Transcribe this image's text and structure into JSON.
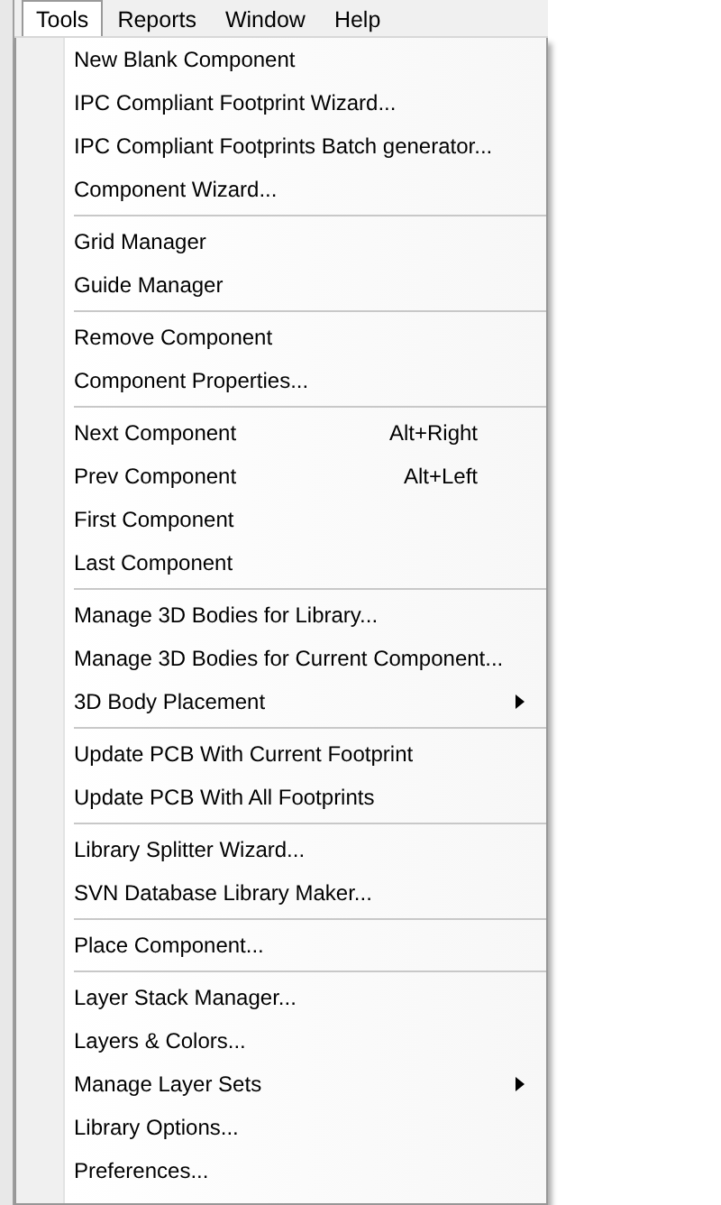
{
  "menubar": {
    "items": [
      {
        "label": "Tools",
        "selected": true
      },
      {
        "label": "Reports",
        "selected": false
      },
      {
        "label": "Window",
        "selected": false
      },
      {
        "label": "Help",
        "selected": false
      }
    ]
  },
  "menu": {
    "groups": [
      {
        "items": [
          {
            "label": "New Blank Component",
            "submenu": false
          },
          {
            "label": "IPC Compliant Footprint Wizard...",
            "submenu": false
          },
          {
            "label": "IPC Compliant Footprints Batch generator...",
            "submenu": false
          },
          {
            "label": "Component Wizard...",
            "submenu": false
          }
        ]
      },
      {
        "items": [
          {
            "label": "Grid Manager",
            "submenu": false
          },
          {
            "label": "Guide Manager",
            "submenu": false
          }
        ]
      },
      {
        "items": [
          {
            "label": "Remove Component",
            "submenu": false
          },
          {
            "label": "Component Properties...",
            "submenu": false
          }
        ]
      },
      {
        "items": [
          {
            "label": "Next Component",
            "shortcut": "Alt+Right",
            "submenu": false
          },
          {
            "label": "Prev Component",
            "shortcut": "Alt+Left",
            "submenu": false
          },
          {
            "label": "First Component",
            "submenu": false
          },
          {
            "label": "Last Component",
            "submenu": false
          }
        ]
      },
      {
        "items": [
          {
            "label": "Manage 3D Bodies for Library...",
            "submenu": false
          },
          {
            "label": "Manage 3D Bodies for Current Component...",
            "submenu": false
          },
          {
            "label": "3D Body Placement",
            "submenu": true
          }
        ]
      },
      {
        "items": [
          {
            "label": "Update PCB With Current Footprint",
            "submenu": false
          },
          {
            "label": "Update PCB With All Footprints",
            "submenu": false
          }
        ]
      },
      {
        "items": [
          {
            "label": "Library Splitter Wizard...",
            "submenu": false
          },
          {
            "label": "SVN Database Library Maker...",
            "submenu": false
          }
        ]
      },
      {
        "items": [
          {
            "label": "Place Component...",
            "submenu": false
          }
        ]
      },
      {
        "items": [
          {
            "label": "Layer Stack Manager...",
            "submenu": false
          },
          {
            "label": "Layers & Colors...",
            "submenu": false
          },
          {
            "label": "Manage Layer Sets",
            "submenu": true
          },
          {
            "label": "Library Options...",
            "submenu": false
          },
          {
            "label": "Preferences...",
            "submenu": false
          }
        ]
      }
    ]
  }
}
